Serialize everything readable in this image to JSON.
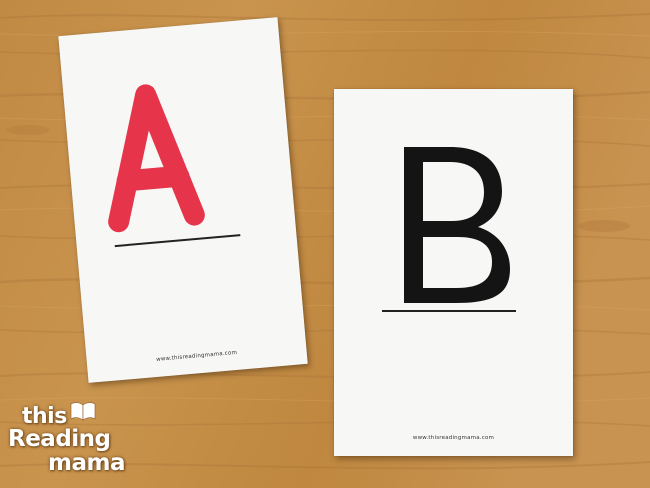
{
  "scene": {
    "background_color": "#c58f47",
    "card_color": "#f7f8f6"
  },
  "card_a": {
    "letter": "A",
    "letter_color": "#e6344a",
    "url": "www.thisreadingmama.com"
  },
  "card_b": {
    "letter": "B",
    "letter_color": "#141414",
    "url": "www.thisreadingmama.com"
  },
  "logo": {
    "line1": "this",
    "line2": "Reading",
    "line3": "mama",
    "color": "#ffffff",
    "icon": "open-book-icon"
  }
}
